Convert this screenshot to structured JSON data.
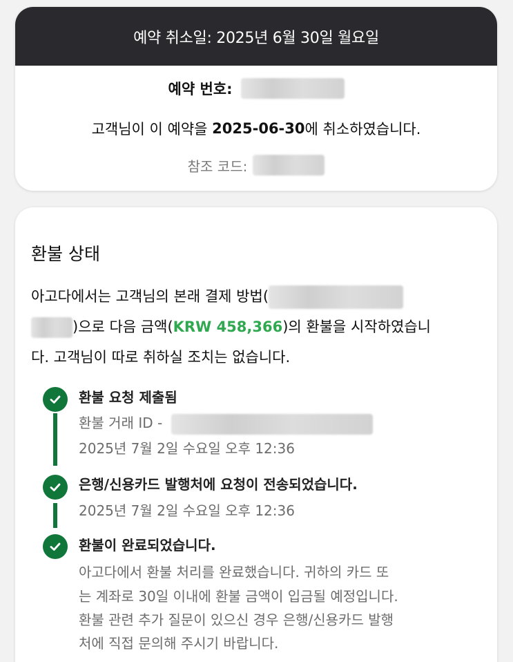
{
  "cancellation": {
    "header": "예약 취소일: 2025년 6월 30일 월요일",
    "booking_label": "예약 번호:",
    "cancel_prefix": "고객님이 이 예약을 ",
    "cancel_date": "2025-06-30",
    "cancel_suffix": "에 취소하였습니다.",
    "reference_label": "참조 코드:"
  },
  "refund": {
    "title": "환불 상태",
    "desc_line1": "아고다에서는 고객님의 본래 결제 방법(",
    "desc_line2_suffix_a": ")으로 다음 금액(",
    "amount": "KRW 458,366",
    "desc_line2_suffix_b": ")의 환불을 시작하였습니",
    "desc_line3": "다. 고객님이 따로 취하실 조치는 없습니다.",
    "steps": [
      {
        "title": "환불 요청 제출됨",
        "transaction_label": "환불 거래 ID -",
        "timestamp": "2025년 7월 2일 수요일 오후 12:36"
      },
      {
        "title": "은행/신용카드 발행처에 요청이 전송되었습니다.",
        "timestamp": "2025년 7월 2일 수요일 오후 12:36"
      },
      {
        "title": "환불이 완료되었습니다.",
        "lines": [
          "아고다에서 환불 처리를 완료했습니다. 귀하의 카드 또",
          "는 계좌로 30일 이내에 환불 금액이 입금될 예정입니다.",
          "환불 관련 추가 질문이 있으신 경우 은행/신용카드 발행",
          "처에 직접 문의해 주시기 바랍니다."
        ]
      }
    ]
  },
  "colors": {
    "header_bg": "#2a2a2e",
    "step_green": "#11763a",
    "amount_green": "#2fa84f"
  },
  "icons": {
    "step_icon": "check-circle-icon"
  }
}
